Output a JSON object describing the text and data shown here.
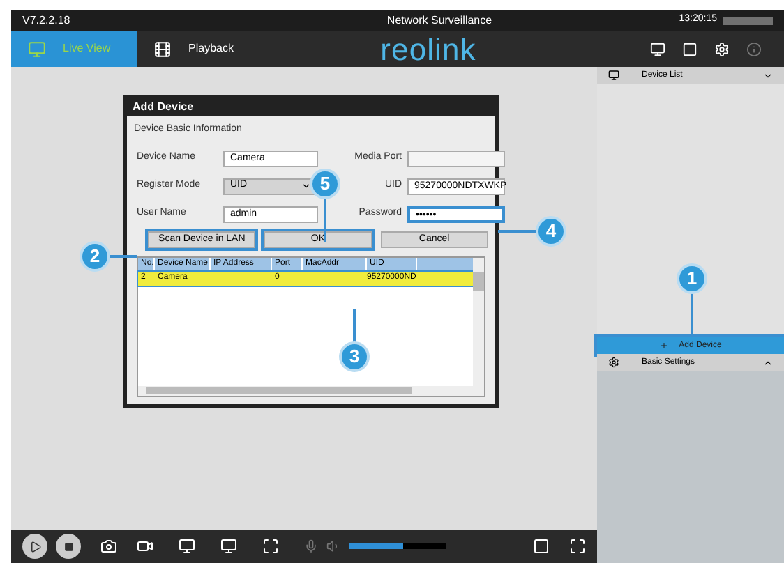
{
  "window": {
    "version": "V7.2.2.18",
    "title": "Network Surveillance",
    "time": "13:20:15"
  },
  "tabs": [
    {
      "label": "Live View",
      "selected": true
    },
    {
      "label": "Playback",
      "selected": false
    }
  ],
  "logo": "reolink",
  "dialog": {
    "title": "Add Device",
    "section": "Device Basic Information",
    "fields": [
      {
        "label": "Device Name",
        "value": "Camera",
        "kind": "text",
        "highlighted": false
      },
      {
        "label": "Media Port",
        "kind": "text",
        "highlighted": false
      },
      {
        "label": "Register Mode",
        "value": "UID",
        "kind": "select",
        "highlighted": false
      },
      {
        "label": "UID",
        "value": "95270000NDTXWKP",
        "kind": "text",
        "highlighted": false
      },
      {
        "label": "User Name",
        "value": "admin",
        "kind": "text",
        "highlighted": false
      },
      {
        "label": "Password",
        "value": "••••••",
        "kind": "text",
        "highlighted": true
      }
    ],
    "buttons": [
      {
        "label": "Scan Device in LAN",
        "highlighted": true
      },
      {
        "label": "OK",
        "highlighted": true
      },
      {
        "label": "Cancel",
        "highlighted": false
      }
    ],
    "table": {
      "columns": [
        "No.",
        "Device Name",
        "IP Address",
        "Port",
        "MacAddr",
        "UID"
      ],
      "rows": [
        {
          "no": "2",
          "device_name": "Camera",
          "port": "0",
          "uid": "95270000ND",
          "selected": true
        }
      ]
    }
  },
  "sidebar": {
    "device_list": "Device List",
    "add_device": {
      "label": "Add Device",
      "highlighted": true
    },
    "basic_settings": "Basic Settings"
  },
  "callouts": [
    {
      "number": "1"
    },
    {
      "number": "2"
    },
    {
      "number": "3"
    },
    {
      "number": "4"
    },
    {
      "number": "5"
    }
  ],
  "volume": {
    "level": 0.55
  }
}
